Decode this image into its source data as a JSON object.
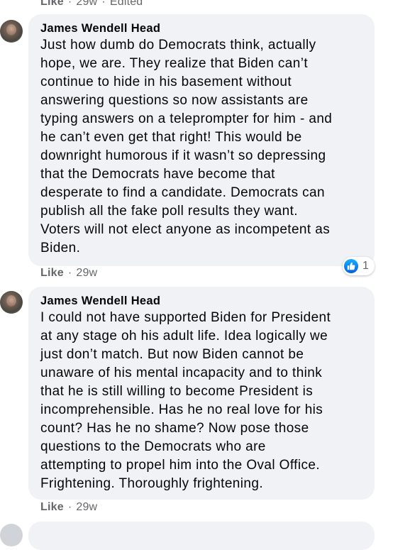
{
  "top_meta": {
    "like": "Like",
    "time": "29w",
    "edited": "Edited"
  },
  "comments": [
    {
      "author": "James Wendell Head",
      "text": "Just how dumb do Democrats think, actually\nhope, we are. They realize that Biden can’t\ncontinue to hide in his basement without\nanswering questions so now assistants are\ntyping answers on a teleprompter for him - and\nhe can’t even get that right! This would be\ndownright humorous if it wasn’t so depressing\nthat the Democrats have become that\ndesperate to find a candidate. Democrats can\npublish all the fake poll results they want.\nVoters will not elect anyone as incompetent as\nBiden.",
      "like": "Like",
      "time": "29w",
      "reaction_icon": "like-thumb-icon",
      "reaction_count": "1"
    },
    {
      "author": "James Wendell Head",
      "text": "I could not have supported Biden for President\nat any stage oh his adult life. Idea logically we\njust don’t match. But now Biden cannot be\nunaware of his mental incapacity and to think\nthat he is still willing to become President is\nincomprehensible. Has he no real love for his\ncount? Has he no shame? Now pose those\nquestions to the Democrats who are\nattempting to propel him into the Oval Office.\nFrightening. Thoroughly frightening.",
      "like": "Like",
      "time": "29w"
    }
  ],
  "colors": {
    "bubble": "#f0f2f5",
    "meta_text": "#65676b",
    "like_blue": "#0062df"
  }
}
